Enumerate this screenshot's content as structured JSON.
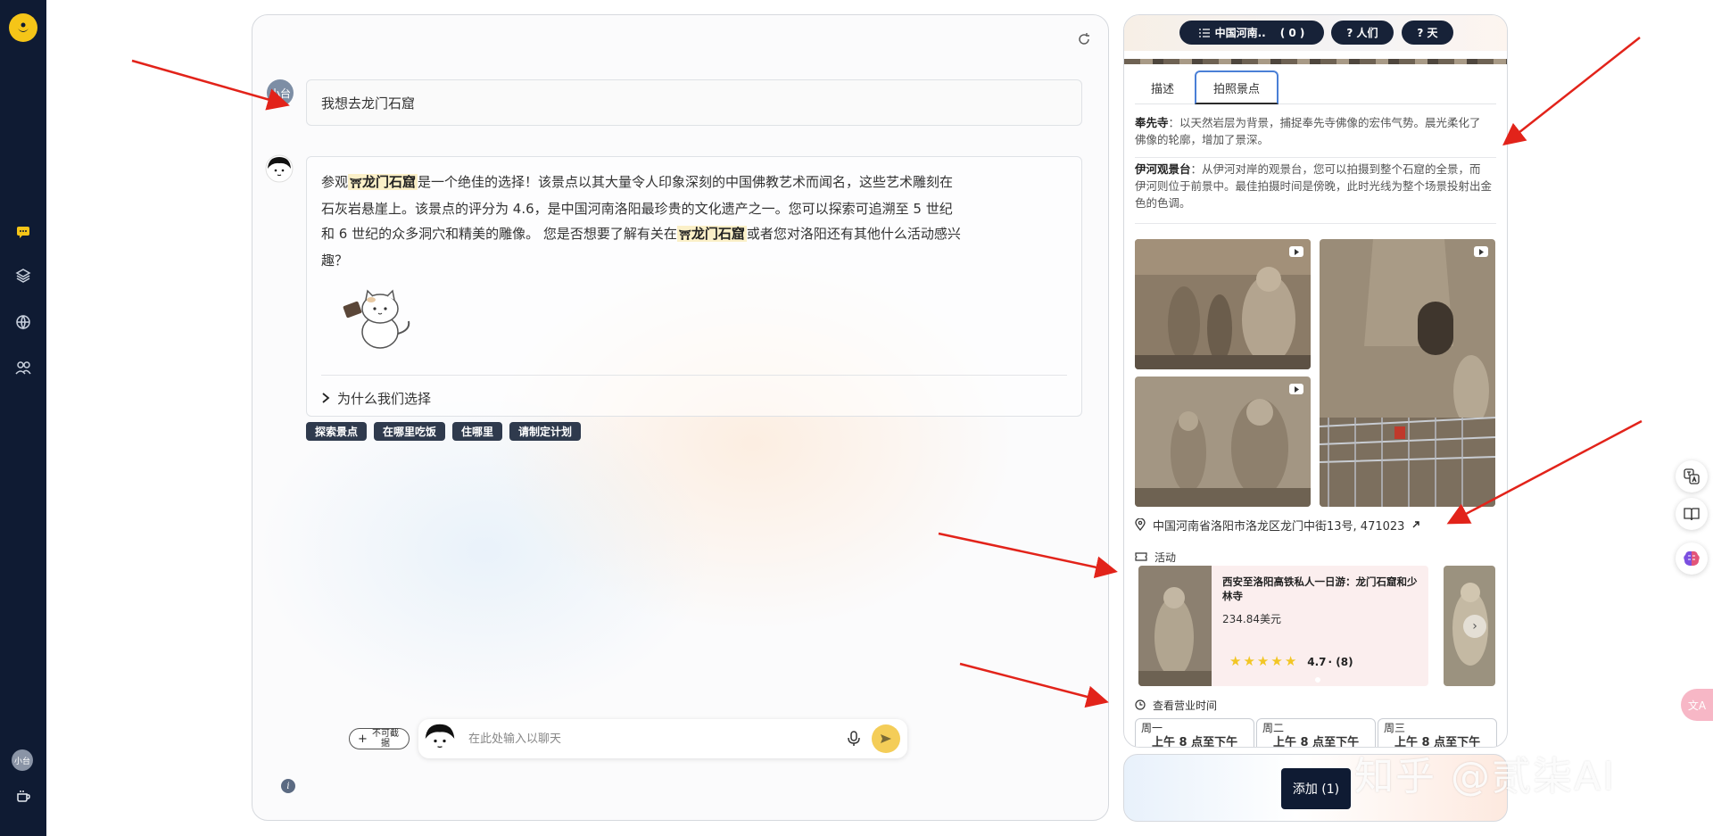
{
  "nav": {
    "items": [
      "chat-icon",
      "layers-icon",
      "globe-icon",
      "users-icon",
      "coffee-icon"
    ],
    "avatar_label": "小台",
    "accent": "#f5c518"
  },
  "chat": {
    "user_avatar_label": "小台",
    "user_message": "我想去龙门石窟",
    "bot": {
      "t1": "参观",
      "place1": "龙门石窟",
      "t2": "是一个绝佳的选择！该景点以其大量令人印象深刻的中国佛教艺术而闻名，这些艺术雕刻在石灰岩悬崖上。该景点的评分为 4.6，是中国河南洛阳最珍贵的文化遗产之一。您可以探索可追溯至 5 世纪和 6 世纪的众多洞穴和精美的雕像。 您是否想要了解有关在",
      "place2": "龙门石窟",
      "t3": "或者您对洛阳还有其他什么活动感兴趣？",
      "why_label": "为什么我们选择"
    },
    "chips": [
      "探索景点",
      "在哪里吃饭",
      "住哪里",
      "请制定计划"
    ],
    "composer": {
      "attach_label": "不可截据",
      "placeholder": "在此处输入以聊天"
    }
  },
  "panel": {
    "pills": {
      "location": "中国河南..",
      "location_count": "( 0 )",
      "people": "? 人们",
      "days": "? 天"
    },
    "tabs": [
      "描述",
      "拍照景点"
    ],
    "active_tab": "拍照景点",
    "spots": [
      {
        "name": "奉先寺",
        "text": "：以天然岩层为背景，捕捉奉先寺佛像的宏伟气势。晨光柔化了佛像的轮廓，增加了景深。"
      },
      {
        "name": "伊河观景台",
        "text": "：从伊河对岸的观景台，您可以拍摄到整个石窟的全景，而伊河则位于前景中。最佳拍摄时间是傍晚，此时光线为整个场景投射出金色的色调。"
      }
    ],
    "address": "中国河南省洛阳市洛龙区龙门中街13号, 471023",
    "activities_label": "活动",
    "tour": {
      "title": "西安至洛阳高铁私人一日游：龙门石窟和少林寺",
      "price": "234.84美元",
      "rating": "4.7",
      "reviews": "· (8)",
      "stars": 5
    },
    "hours_label": "查看营业时间",
    "hours": [
      {
        "day": "周一",
        "time": "上午 8 点至下午"
      },
      {
        "day": "周二",
        "time": "上午 8 点至下午"
      },
      {
        "day": "周三",
        "time": "上午 8 点至下午"
      }
    ],
    "add_button": "添加 (1)"
  },
  "watermark": "知乎 @贰柒AI",
  "colors": {
    "nav_bg": "#0f1b33",
    "pill_bg": "#172238",
    "chip_bg": "#2f3a4d",
    "highlight": "#fbf0c8",
    "arrow": "#e2231a"
  }
}
